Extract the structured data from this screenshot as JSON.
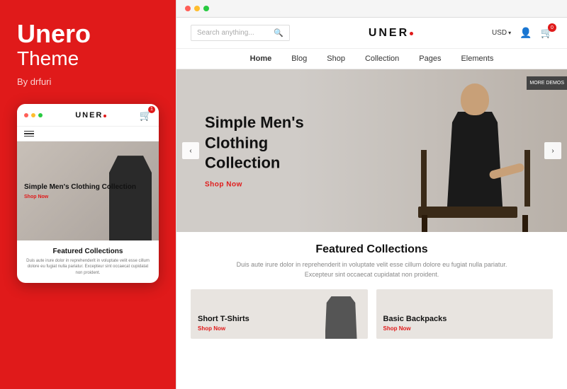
{
  "left": {
    "brand": "Unero",
    "theme": "Theme",
    "author": "By drfuri",
    "mobile": {
      "dots": [
        "red",
        "yellow",
        "green"
      ],
      "logo": "UNERO",
      "cart_count": "1",
      "hero_title": "Simple Men's Clothing Collection",
      "hero_btn": "Shop Now",
      "featured_title": "Featured Collections",
      "featured_desc": "Duis aute irure dolor in reprehenderit in voluptate velit esse cillum dolore eu fugiat nulla pariatur. Excepteur sint occaecat cupidatat non proident."
    }
  },
  "right": {
    "browser": {
      "dots": [
        "red",
        "yellow",
        "green"
      ]
    },
    "header": {
      "search_placeholder": "Search anything...",
      "logo": "UNERO",
      "currency": "USD",
      "cart_count": "0"
    },
    "nav": {
      "items": [
        {
          "label": "Home",
          "active": true
        },
        {
          "label": "Blog"
        },
        {
          "label": "Shop"
        },
        {
          "label": "Collection"
        },
        {
          "label": "Pages"
        },
        {
          "label": "Elements"
        }
      ]
    },
    "hero": {
      "title": "Simple Men's Clothing Collection",
      "btn": "Shop Now",
      "more_demos": "MORE\nDEMOS"
    },
    "featured": {
      "title": "Featured Collections",
      "desc": "Duis aute irure dolor in reprehenderit in voluptate velit esse cillum dolore eu fugiat nulla pariatur. Excepteur sint occaecat cupidatat non proident.",
      "cards": [
        {
          "title": "Short T-Shirts",
          "btn": "Shop Now"
        },
        {
          "title": "Basic Backpacks",
          "btn": "Shop Now"
        }
      ]
    }
  }
}
